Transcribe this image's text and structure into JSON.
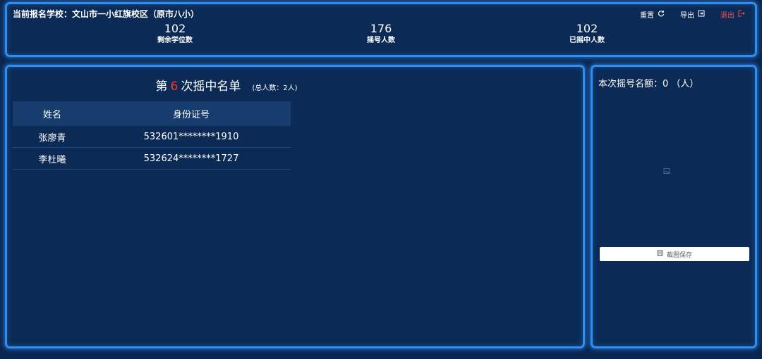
{
  "header": {
    "school_label": "当前报名学校：文山市一小红旗校区（原市八小）",
    "actions": {
      "reset": "重置",
      "export": "导出",
      "logout": "退出"
    },
    "stats": [
      {
        "value": "102",
        "label": "剩余学位数"
      },
      {
        "value": "176",
        "label": "摇号人数"
      },
      {
        "value": "102",
        "label": "已摇中人数"
      }
    ]
  },
  "list": {
    "title_prefix": "第",
    "round": "6",
    "title_suffix": "次摇中名单",
    "total_note": "(总人数：2人)",
    "columns": [
      "姓名",
      "身份证号"
    ],
    "rows": [
      {
        "name": "张廖青",
        "id": "532601********1910"
      },
      {
        "name": "李杜曦",
        "id": "532624********1727"
      }
    ]
  },
  "side": {
    "quota_label": "本次摇号名额：0 （人）",
    "save_button": "截图保存"
  },
  "colors": {
    "background": "#0b2650",
    "panel_border": "#2f8ef0",
    "accent_red": "#ff3030",
    "logout_red": "#ff4a4a"
  },
  "icons": [
    "refresh-icon",
    "export-icon",
    "logout-icon",
    "image-placeholder-icon",
    "save-icon"
  ]
}
